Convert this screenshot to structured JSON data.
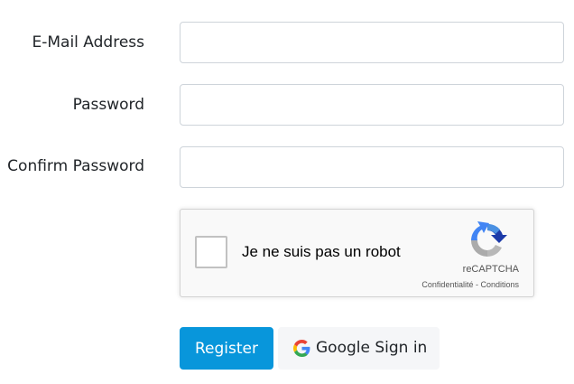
{
  "form": {
    "email_label": "E-Mail Address",
    "email_value": "",
    "password_label": "Password",
    "password_value": "",
    "confirm_label": "Confirm Password",
    "confirm_value": ""
  },
  "recaptcha": {
    "checkbox_label": "Je ne suis pas un robot",
    "brand": "reCAPTCHA",
    "privacy": "Confidentialité",
    "separator": " - ",
    "terms": "Conditions",
    "checked": false
  },
  "buttons": {
    "register": "Register",
    "google_signin": "Google Sign in"
  },
  "colors": {
    "primary": "#0896db",
    "google_bg": "#f5f6f8",
    "recaptcha_bg": "#f9f9f9"
  },
  "icons": {
    "recaptcha_logo": "recaptcha-logo-icon",
    "google": "google-g-icon"
  }
}
